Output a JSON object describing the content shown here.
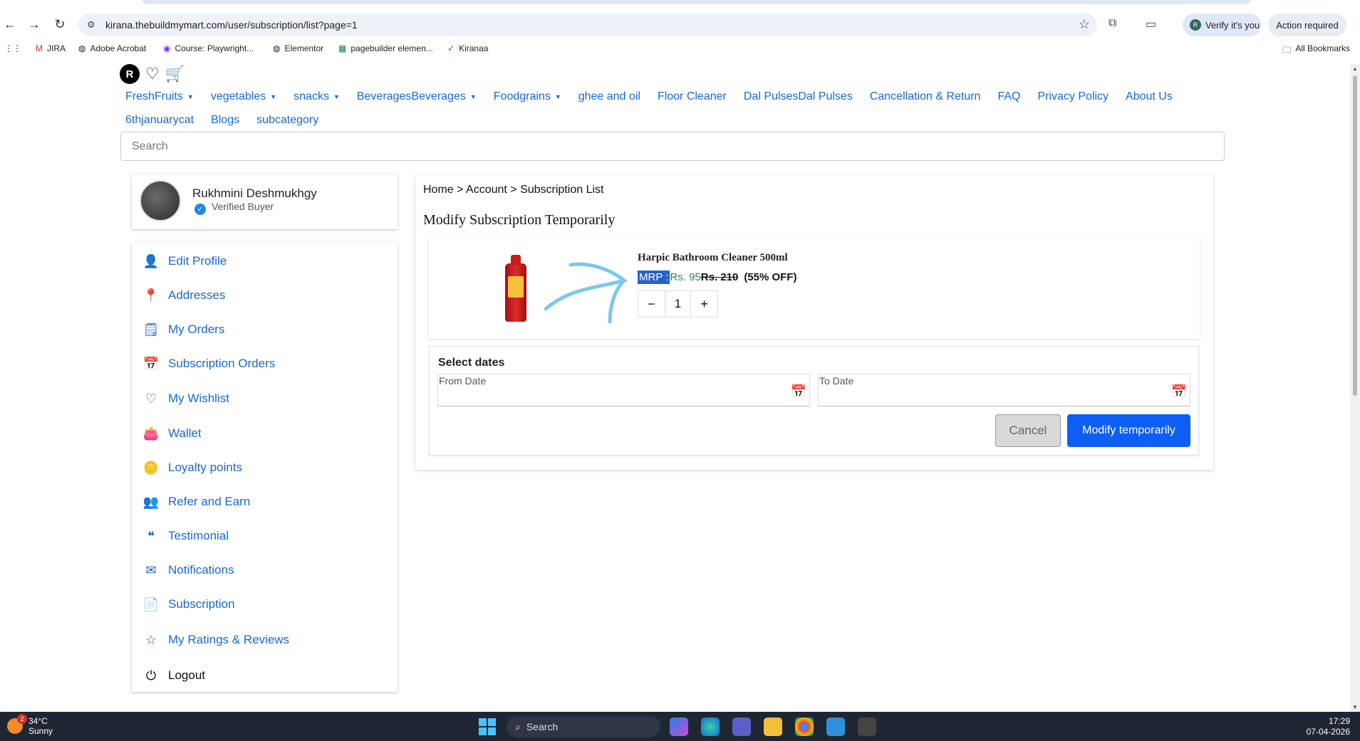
{
  "browser": {
    "url": "kirana.thebuildmymart.com/user/subscription/list?page=1",
    "verify_label": "Verify it's you",
    "verify_initial": "R",
    "action_label": "Action required",
    "bookmarks": [
      {
        "label": "JIRA",
        "icon": "gmail-icon"
      },
      {
        "label": "Adobe Acrobat",
        "icon": "globe-icon"
      },
      {
        "label": "Course: Playwright...",
        "icon": "course-icon"
      },
      {
        "label": "Elementor",
        "icon": "globe-icon"
      },
      {
        "label": "pagebuilder elemen...",
        "icon": "sheets-icon"
      },
      {
        "label": "Kiranaa",
        "icon": "check-icon"
      }
    ],
    "all_bookmarks": "All Bookmarks"
  },
  "header": {
    "user_initial": "R",
    "nav": [
      {
        "label": "FreshFruits",
        "dropdown": true
      },
      {
        "label": "vegetables",
        "dropdown": true
      },
      {
        "label": "snacks",
        "dropdown": true
      },
      {
        "label": "BeveragesBeverages",
        "dropdown": true
      },
      {
        "label": "Foodgrains",
        "dropdown": true
      },
      {
        "label": "ghee and oil",
        "dropdown": false
      },
      {
        "label": "Floor Cleaner",
        "dropdown": false
      },
      {
        "label": "Dal PulsesDal Pulses",
        "dropdown": false
      },
      {
        "label": "Cancellation & Return",
        "dropdown": false
      },
      {
        "label": "FAQ",
        "dropdown": false
      },
      {
        "label": "Privacy Policy",
        "dropdown": false
      },
      {
        "label": "About Us",
        "dropdown": false
      }
    ],
    "nav_row2": [
      "6thjanuarycat",
      "Blogs",
      "subcategory"
    ],
    "search_placeholder": "Search"
  },
  "profile": {
    "name": "Rukhmini Deshmukhgy",
    "status": "Verified Buyer"
  },
  "sidebar": {
    "items": [
      {
        "label": "Edit Profile",
        "icon": "user-icon",
        "glyph": "👤"
      },
      {
        "label": "Addresses",
        "icon": "location-pin-icon",
        "glyph": "📍"
      },
      {
        "label": "My Orders",
        "icon": "orders-icon",
        "glyph": "🗒"
      },
      {
        "label": "Subscription Orders",
        "icon": "calendar-icon",
        "glyph": "📅"
      },
      {
        "label": "My Wishlist",
        "icon": "heart-icon",
        "glyph": "♡"
      },
      {
        "label": "Wallet",
        "icon": "wallet-icon",
        "glyph": "👛"
      },
      {
        "label": "Loyalty points",
        "icon": "coins-icon",
        "glyph": "🪙"
      },
      {
        "label": "Refer and Earn",
        "icon": "refer-icon",
        "glyph": "👥"
      },
      {
        "label": "Testimonial",
        "icon": "quote-icon",
        "glyph": "❝"
      },
      {
        "label": "Notifications",
        "icon": "mail-icon",
        "glyph": "✉"
      },
      {
        "label": "Subscription",
        "icon": "document-icon",
        "glyph": "📄"
      },
      {
        "label": "My Ratings & Reviews",
        "icon": "star-icon",
        "glyph": "☆"
      }
    ],
    "logout": "Logout"
  },
  "content": {
    "breadcrumb": "Home > Account > Subscription List",
    "title": "Modify Subscription Temporarily",
    "product": {
      "name": "Harpic Bathroom Cleaner 500ml",
      "mrp_label": "MRP :",
      "price": "Rs. 95",
      "old_price": "Rs. 210",
      "discount": "(55% OFF)",
      "quantity": "1",
      "minus": "−",
      "plus": "+"
    },
    "dates": {
      "title": "Select dates",
      "from_label": "From Date",
      "to_label": "To Date"
    },
    "cancel_label": "Cancel",
    "modify_label": "Modify temporarily"
  },
  "taskbar": {
    "temperature": "34°C",
    "weather": "Sunny",
    "notification_count": "2",
    "search_label": "Search",
    "time": "17:29",
    "date": "07-04-2026"
  },
  "colors": {
    "link": "#1967d2",
    "primary_button": "#0d5ef4",
    "price_green": "#2d8a4e",
    "taskbar": "#1f2633"
  }
}
